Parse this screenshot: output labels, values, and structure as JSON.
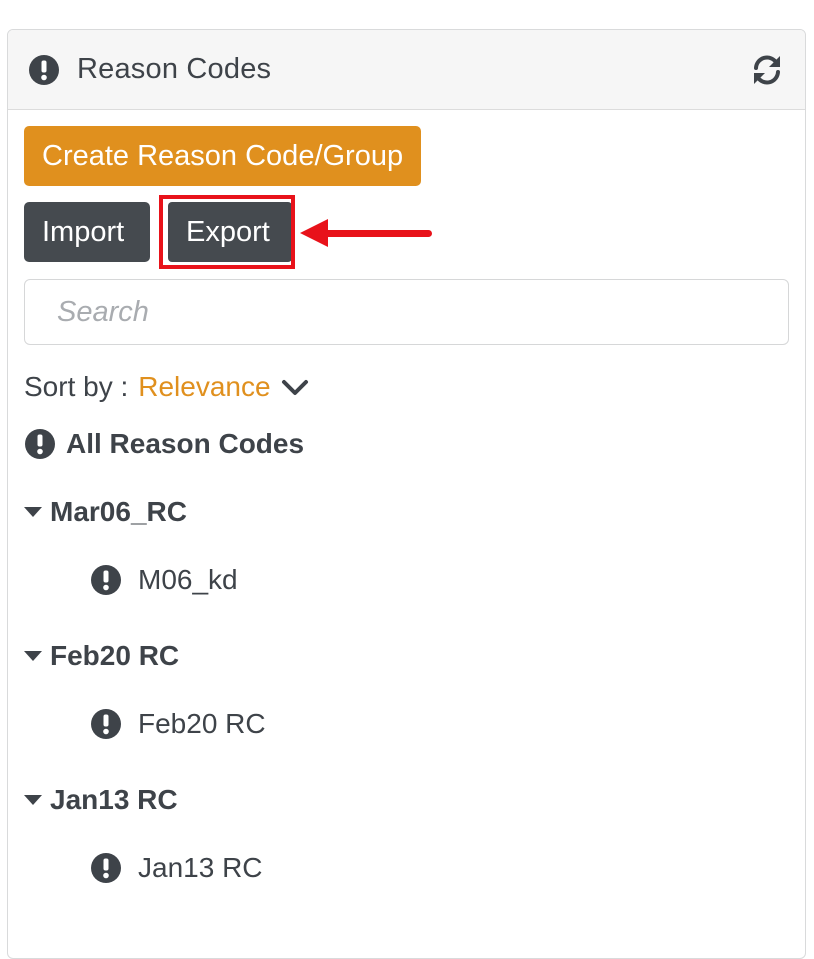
{
  "panel": {
    "title": "Reason Codes",
    "header_icon": "exclamation-circle-icon",
    "refresh_icon": "refresh-icon"
  },
  "actions": {
    "create_label": "Create Reason Code/Group",
    "import_label": "Import",
    "export_label": "Export"
  },
  "search": {
    "placeholder": "Search",
    "value": ""
  },
  "sort": {
    "label": "Sort by :",
    "value": "Relevance",
    "icon": "chevron-down-icon"
  },
  "all_codes": {
    "label": "All Reason Codes",
    "icon": "exclamation-circle-icon"
  },
  "groups": [
    {
      "title": "Mar06_RC",
      "items": [
        {
          "label": "M06_kd"
        }
      ]
    },
    {
      "title": "Feb20 RC",
      "items": [
        {
          "label": "Feb20 RC"
        }
      ]
    },
    {
      "title": "Jan13 RC",
      "items": [
        {
          "label": "Jan13 RC"
        }
      ]
    }
  ],
  "colors": {
    "accent": "#e0901e",
    "dark_button": "#454a4f",
    "highlight": "#e8121a",
    "text": "#3e4349"
  }
}
